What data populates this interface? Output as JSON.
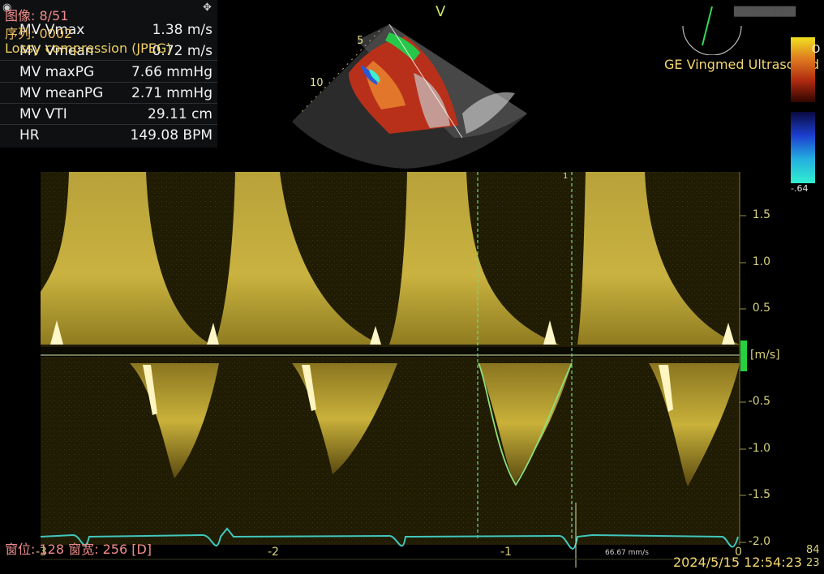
{
  "header": {
    "image_counter": "图像: 8/51",
    "series": "序列: 0002",
    "compression": "Lossy compression (JPEG)",
    "mode_marker": "V",
    "vendor": "GE Vingmed Ultrasound"
  },
  "measurements": [
    {
      "label": "MV Vmax",
      "value": "1.38 m/s"
    },
    {
      "label": "MV Vmean",
      "value": "0.72 m/s"
    },
    {
      "label": "MV maxPG",
      "value": "7.66 mmHg"
    },
    {
      "label": "MV meanPG",
      "value": "2.71 mmHg"
    },
    {
      "label": "MV VTI",
      "value": "29.11 cm"
    },
    {
      "label": "HR",
      "value": "149.08 BPM"
    }
  ],
  "sector": {
    "depth_marks": [
      "5",
      "10"
    ]
  },
  "color_bar": {
    "top_value": "O",
    "bottom_value": "-.64"
  },
  "doppler": {
    "unit": "[m/s]",
    "y_ticks": [
      "1.5",
      "1.0",
      "0.5",
      "-0.5",
      "-1.0",
      "-1.5",
      "-2.0"
    ],
    "x_ticks": [
      "-3",
      "-2",
      "-1",
      "0"
    ],
    "sweep_speed": "66.67 mm/s",
    "cursor_marker": "1",
    "corner_values": [
      "84",
      "23"
    ]
  },
  "footer": {
    "window": "窗位: 128 窗宽: 256 [D]",
    "datetime": "2024/5/15 12:54:23"
  },
  "colors": {
    "accent_yellow": "#f5d76e",
    "trace_cyan": "#3ccfc0",
    "measure_green": "#8ee07a"
  }
}
